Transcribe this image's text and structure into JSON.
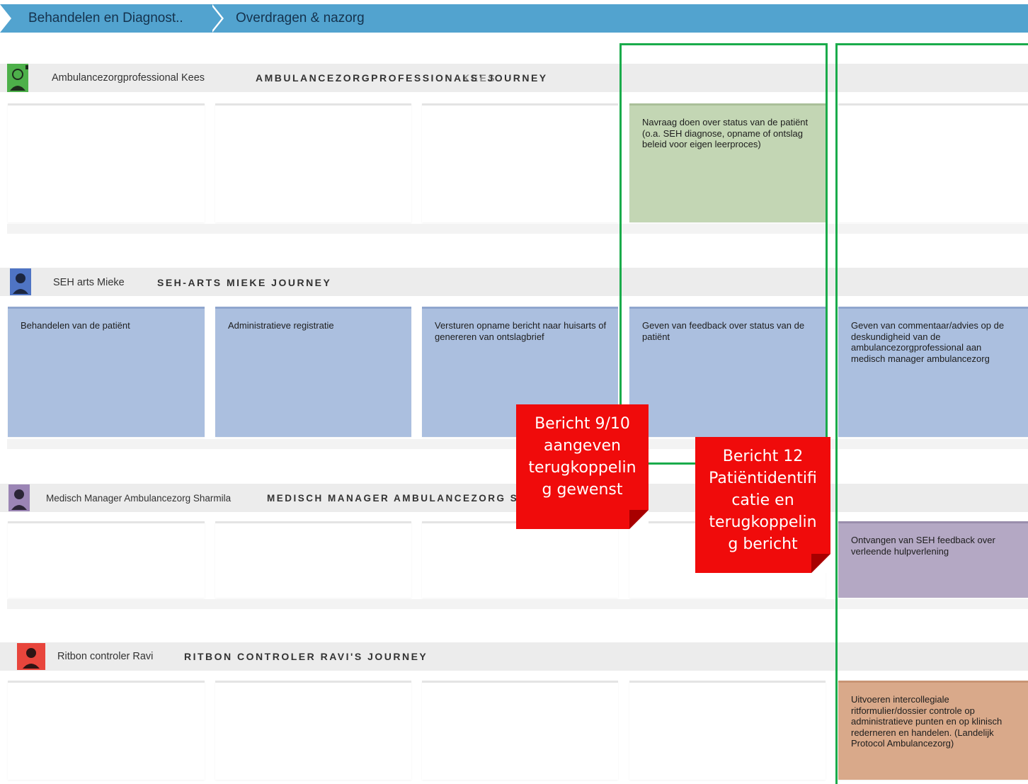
{
  "phases": [
    {
      "label": "Behandelen en Diagnost.."
    },
    {
      "label": "Overdragen & nazorg"
    }
  ],
  "lanes": [
    {
      "name": "Ambulancezorgprofessional Kees",
      "title": "AMBULANCEZORGPROFESSIONALS’ JOURNEY",
      "title_overlap": "KEES",
      "avatar_color": "#4db04a",
      "cards": [
        "",
        "",
        "",
        "Navraag doen over status van de patiënt (o.a. SEH diagnose, opname of ontslag beleid voor eigen leerproces)",
        ""
      ]
    },
    {
      "name": "SEH arts Mieke",
      "title": "SEH-ARTS MIEKE JOURNEY",
      "avatar_color": "#4f74c4",
      "cards": [
        "Behandelen van de patiënt",
        "Administratieve registratie",
        "Versturen opname bericht naar huisarts of genereren van ontslagbrief",
        "Geven van feedback over status van de patiënt",
        "Geven van commentaar/advies op de deskundigheid van de ambulancezorgprofessional aan medisch manager ambulancezorg"
      ]
    },
    {
      "name": "Medisch Manager Ambulancezorg Sharmila",
      "title": "MEDISCH MANAGER AMBULANCEZORG SH",
      "avatar_color": "#9b85b5",
      "cards": [
        "",
        "",
        "",
        "",
        "Ontvangen van SEH feedback over verleende hulpverlening"
      ]
    },
    {
      "name": "Ritbon controler Ravi",
      "title": "RITBON CONTROLER RAVI'S JOURNEY",
      "avatar_color": "#e8453c",
      "cards": [
        "",
        "",
        "",
        "",
        "Uitvoeren intercollegiale ritformulier/dossier controle op administratieve punten en op klinisch rederneren en handelen. (Landelijk Protocol Ambulancezorg)"
      ]
    }
  ],
  "notes": [
    {
      "text_lines": [
        "Bericht 9/10",
        "aangeven",
        "terugkoppelin",
        "g gewenst"
      ]
    },
    {
      "text_lines": [
        "Bericht 12",
        "Patiëntidentifi",
        "catie en",
        "terugkoppelin",
        "g bericht"
      ]
    }
  ],
  "colors": {
    "phase_bar": "#52a3cf",
    "frame_green": "#1aab4b",
    "note_red": "#f00b0b",
    "card_green": "#c3d6b4",
    "card_blue": "#abbfdf",
    "card_purple": "#b4a8c4",
    "card_orange": "#d9a98a"
  }
}
